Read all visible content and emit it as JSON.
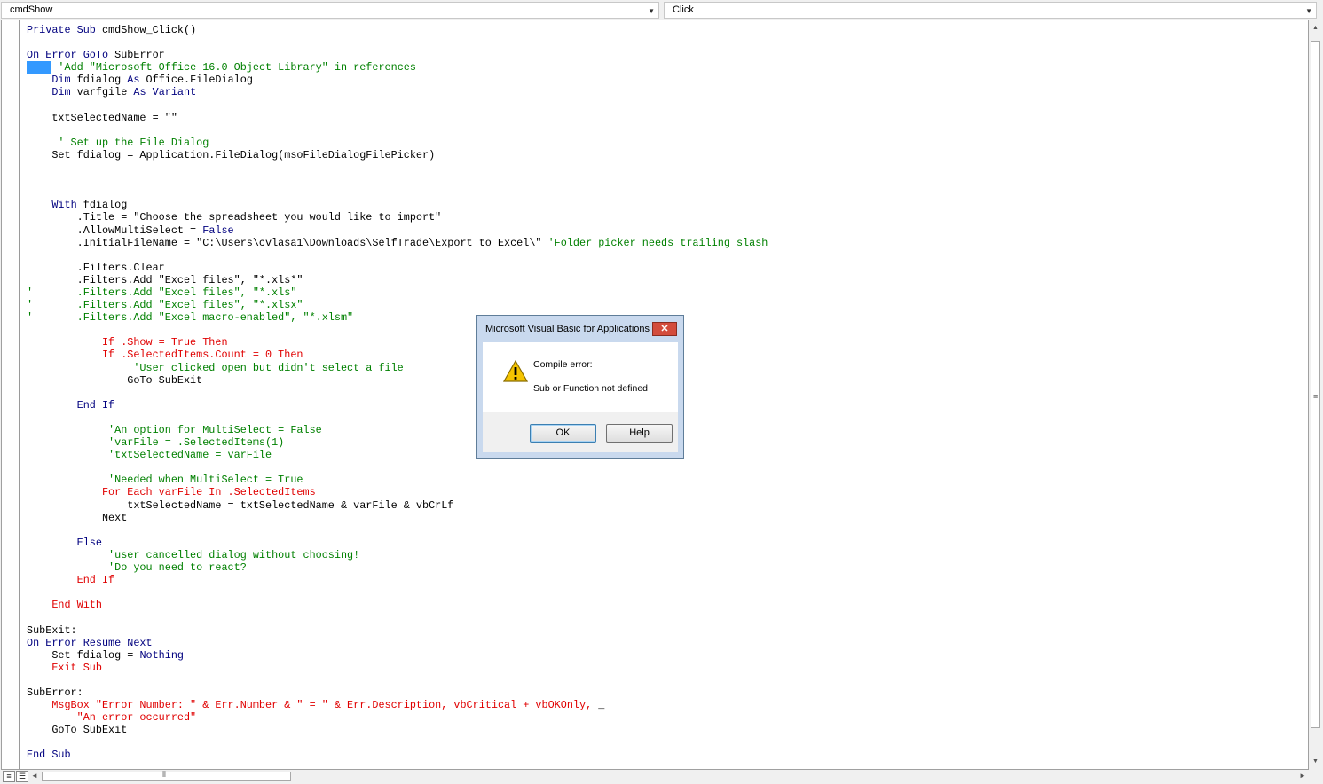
{
  "toolbar": {
    "object_combo": "cmdShow",
    "procedure_combo": "Click"
  },
  "code": {
    "lines": [
      [
        [
          "kw",
          "Private Sub "
        ],
        [
          "",
          "cmdShow_Click()"
        ]
      ],
      [],
      [
        [
          "kw",
          "On Error GoTo "
        ],
        [
          "",
          "SubError"
        ]
      ],
      [
        [
          "sel",
          "    "
        ],
        [
          "cm",
          " 'Add \"Microsoft Office 16.0 Object Library\" in references"
        ]
      ],
      [
        [
          "",
          "    "
        ],
        [
          "kw",
          "Dim "
        ],
        [
          "",
          "fdialog "
        ],
        [
          "kw",
          "As "
        ],
        [
          "",
          "Office.FileDialog"
        ]
      ],
      [
        [
          "",
          "    "
        ],
        [
          "kw",
          "Dim "
        ],
        [
          "",
          "varfgile "
        ],
        [
          "kw",
          "As Variant"
        ]
      ],
      [],
      [
        [
          "",
          "    txtSelectedName = \"\""
        ]
      ],
      [],
      [
        [
          "cm",
          "     ' Set up the File Dialog"
        ]
      ],
      [
        [
          "",
          "    Set fdialog = Application.FileDialog(msoFileDialogFilePicker)"
        ]
      ],
      [],
      [],
      [],
      [
        [
          "",
          "    "
        ],
        [
          "kw",
          "With "
        ],
        [
          "",
          "fdialog"
        ]
      ],
      [
        [
          "",
          "        .Title = \"Choose the spreadsheet you would like to import\""
        ]
      ],
      [
        [
          "",
          "        .AllowMultiSelect = "
        ],
        [
          "kw",
          "False"
        ]
      ],
      [
        [
          "",
          "        .InitialFileName = \"C:\\Users\\cvlasa1\\Downloads\\SelfTrade\\Export to Excel\\\" "
        ],
        [
          "cm",
          "'Folder picker needs trailing slash"
        ]
      ],
      [],
      [
        [
          "",
          "        .Filters.Clear"
        ]
      ],
      [
        [
          "",
          "        .Filters.Add \"Excel files\", \"*.xls*\""
        ]
      ],
      [
        [
          "cm",
          "'       .Filters.Add \"Excel files\", \"*.xls\""
        ]
      ],
      [
        [
          "cm",
          "'       .Filters.Add \"Excel files\", \"*.xlsx\""
        ]
      ],
      [
        [
          "cm",
          "'       .Filters.Add \"Excel macro-enabled\", \"*.xlsm\""
        ]
      ],
      [],
      [
        [
          "er",
          "            If .Show = True Then"
        ]
      ],
      [
        [
          "er",
          "            If .SelectedItems.Count = 0 Then"
        ]
      ],
      [
        [
          "cm",
          "                 'User clicked open but didn't select a file"
        ]
      ],
      [
        [
          "",
          "                GoTo SubExit"
        ]
      ],
      [],
      [
        [
          "",
          "        "
        ],
        [
          "kw",
          "End If"
        ]
      ],
      [],
      [
        [
          "cm",
          "             'An option for MultiSelect = False"
        ]
      ],
      [
        [
          "cm",
          "             'varFile = .SelectedItems(1)"
        ]
      ],
      [
        [
          "cm",
          "             'txtSelectedName = varFile"
        ]
      ],
      [],
      [
        [
          "cm",
          "             'Needed when MultiSelect = True"
        ]
      ],
      [
        [
          "er",
          "            For Each varFile In .SelectedItems"
        ]
      ],
      [
        [
          "",
          "                txtSelectedName = txtSelectedName & varFile & vbCrLf"
        ]
      ],
      [
        [
          "",
          "            Next"
        ]
      ],
      [],
      [
        [
          "",
          "        "
        ],
        [
          "kw",
          "Else"
        ]
      ],
      [
        [
          "cm",
          "             'user cancelled dialog without choosing!"
        ]
      ],
      [
        [
          "cm",
          "             'Do you need to react?"
        ]
      ],
      [
        [
          "er",
          "        End If"
        ]
      ],
      [],
      [
        [
          "er",
          "    End With"
        ]
      ],
      [],
      [
        [
          "",
          "SubExit:"
        ]
      ],
      [
        [
          "kw",
          "On Error Resume Next"
        ]
      ],
      [
        [
          "",
          "    Set fdialog = "
        ],
        [
          "kw",
          "Nothing"
        ]
      ],
      [
        [
          "er",
          "    Exit Sub"
        ]
      ],
      [],
      [
        [
          "",
          "SubError:"
        ]
      ],
      [
        [
          "er",
          "    MsgBox \"Error Number: \" & Err.Number & \" = \" & Err.Description, vbCritical + vbOKOnly, "
        ],
        [
          "",
          "_"
        ]
      ],
      [
        [
          "er",
          "        \"An error occurred\""
        ]
      ],
      [
        [
          "",
          "    GoTo SubExit"
        ]
      ],
      [],
      [
        [
          "kw",
          "End Sub"
        ]
      ]
    ]
  },
  "dialog": {
    "title": "Microsoft Visual Basic for Applications",
    "close_label": "✕",
    "icon": "warning-icon",
    "message_heading": "Compile error:",
    "message_detail": "Sub or Function not defined",
    "ok_label": "OK",
    "help_label": "Help"
  },
  "scroll": {
    "up_arrow": "▲",
    "down_arrow": "▼",
    "left_arrow": "◄",
    "right_arrow": "►",
    "grip": "≡",
    "hgrip": "⦀"
  },
  "colors": {
    "keyword": "#00007f",
    "comment": "#008000",
    "error": "#e00000",
    "selection": "#3399ff"
  }
}
